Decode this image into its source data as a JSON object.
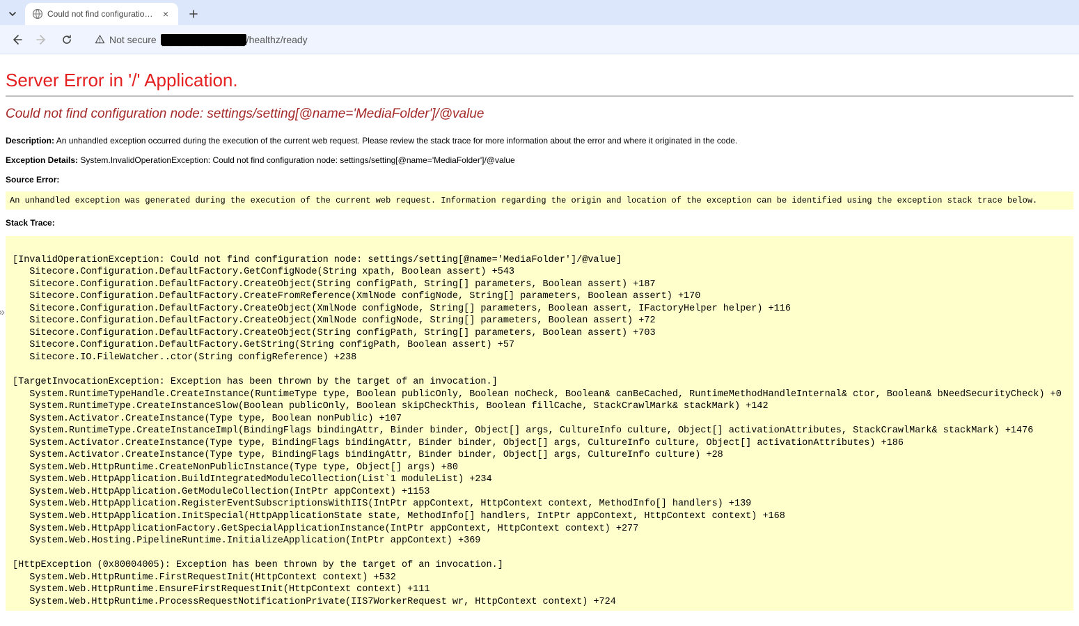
{
  "browser": {
    "tab_title": "Could not find configuration no",
    "security_label": "Not secure",
    "url_redacted_prefix": "████████████",
    "url_tail": "/healthz/ready"
  },
  "page": {
    "heading": "Server Error in '/' Application.",
    "subheading": "Could not find configuration node: settings/setting[@name='MediaFolder']/@value",
    "description_label": "Description:",
    "description_text": " An unhandled exception occurred during the execution of the current web request. Please review the stack trace for more information about the error and where it originated in the code.",
    "exception_label": "Exception Details:",
    "exception_text": " System.InvalidOperationException: Could not find configuration node: settings/setting[@name='MediaFolder']/@value",
    "source_error_label": "Source Error:",
    "source_error_box": "An unhandled exception was generated during the execution of the current web request. Information regarding the origin and location of the exception can be identified using the exception stack trace below.",
    "stack_trace_label": "Stack Trace:",
    "stack_trace": "\n[InvalidOperationException: Could not find configuration node: settings/setting[@name='MediaFolder']/@value]\n   Sitecore.Configuration.DefaultFactory.GetConfigNode(String xpath, Boolean assert) +543\n   Sitecore.Configuration.DefaultFactory.CreateObject(String configPath, String[] parameters, Boolean assert) +187\n   Sitecore.Configuration.DefaultFactory.CreateFromReference(XmlNode configNode, String[] parameters, Boolean assert) +170\n   Sitecore.Configuration.DefaultFactory.CreateObject(XmlNode configNode, String[] parameters, Boolean assert, IFactoryHelper helper) +116\n   Sitecore.Configuration.DefaultFactory.CreateObject(XmlNode configNode, String[] parameters, Boolean assert) +72\n   Sitecore.Configuration.DefaultFactory.CreateObject(String configPath, String[] parameters, Boolean assert) +703\n   Sitecore.Configuration.DefaultFactory.GetString(String configPath, Boolean assert) +57\n   Sitecore.IO.FileWatcher..ctor(String configReference) +238\n\n[TargetInvocationException: Exception has been thrown by the target of an invocation.]\n   System.RuntimeTypeHandle.CreateInstance(RuntimeType type, Boolean publicOnly, Boolean noCheck, Boolean& canBeCached, RuntimeMethodHandleInternal& ctor, Boolean& bNeedSecurityCheck) +0\n   System.RuntimeType.CreateInstanceSlow(Boolean publicOnly, Boolean skipCheckThis, Boolean fillCache, StackCrawlMark& stackMark) +142\n   System.Activator.CreateInstance(Type type, Boolean nonPublic) +107\n   System.RuntimeType.CreateInstanceImpl(BindingFlags bindingAttr, Binder binder, Object[] args, CultureInfo culture, Object[] activationAttributes, StackCrawlMark& stackMark) +1476\n   System.Activator.CreateInstance(Type type, BindingFlags bindingAttr, Binder binder, Object[] args, CultureInfo culture, Object[] activationAttributes) +186\n   System.Activator.CreateInstance(Type type, BindingFlags bindingAttr, Binder binder, Object[] args, CultureInfo culture) +28\n   System.Web.HttpRuntime.CreateNonPublicInstance(Type type, Object[] args) +80\n   System.Web.HttpApplication.BuildIntegratedModuleCollection(List`1 moduleList) +234\n   System.Web.HttpApplication.GetModuleCollection(IntPtr appContext) +1153\n   System.Web.HttpApplication.RegisterEventSubscriptionsWithIIS(IntPtr appContext, HttpContext context, MethodInfo[] handlers) +139\n   System.Web.HttpApplication.InitSpecial(HttpApplicationState state, MethodInfo[] handlers, IntPtr appContext, HttpContext context) +168\n   System.Web.HttpApplicationFactory.GetSpecialApplicationInstance(IntPtr appContext, HttpContext context) +277\n   System.Web.Hosting.PipelineRuntime.InitializeApplication(IntPtr appContext) +369\n\n[HttpException (0x80004005): Exception has been thrown by the target of an invocation.]\n   System.Web.HttpRuntime.FirstRequestInit(HttpContext context) +532\n   System.Web.HttpRuntime.EnsureFirstRequestInit(HttpContext context) +111\n   System.Web.HttpRuntime.ProcessRequestNotificationPrivate(IIS7WorkerRequest wr, HttpContext context) +724"
  }
}
